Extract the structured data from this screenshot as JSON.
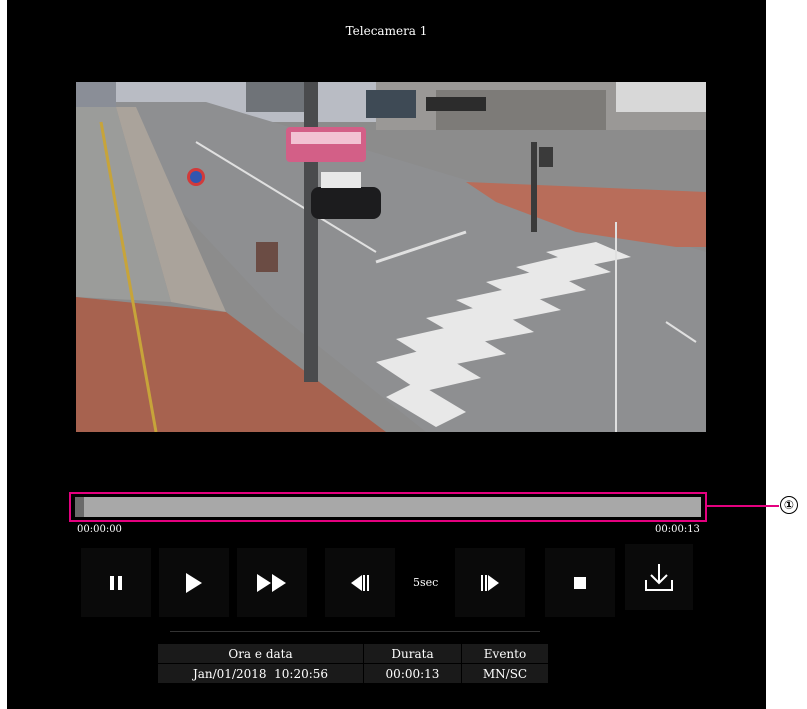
{
  "player": {
    "title": "Telecamera 1",
    "icons": {
      "pause": "pause-icon",
      "play": "play-icon",
      "fast_forward": "fast-forward-icon",
      "skip_back": "skip-back-icon",
      "skip_forward": "skip-forward-icon",
      "stop": "stop-icon",
      "download": "download-icon"
    },
    "colors": {
      "background": "#000000",
      "highlight": "#e4007f",
      "track": "#a8a8a8",
      "button": "#0a0a0a"
    }
  },
  "timeline": {
    "start_time": "00:00:00",
    "end_time": "00:00:13",
    "progress": 0.015,
    "callout_number": "①"
  },
  "controls": {
    "skip_label": "5sec"
  },
  "recording_info": {
    "headers": [
      "Ora e data",
      "Durata",
      "Evento"
    ],
    "row": [
      "Jan/01/2018  10:20:56",
      "00:00:13",
      "MN/SC"
    ]
  }
}
